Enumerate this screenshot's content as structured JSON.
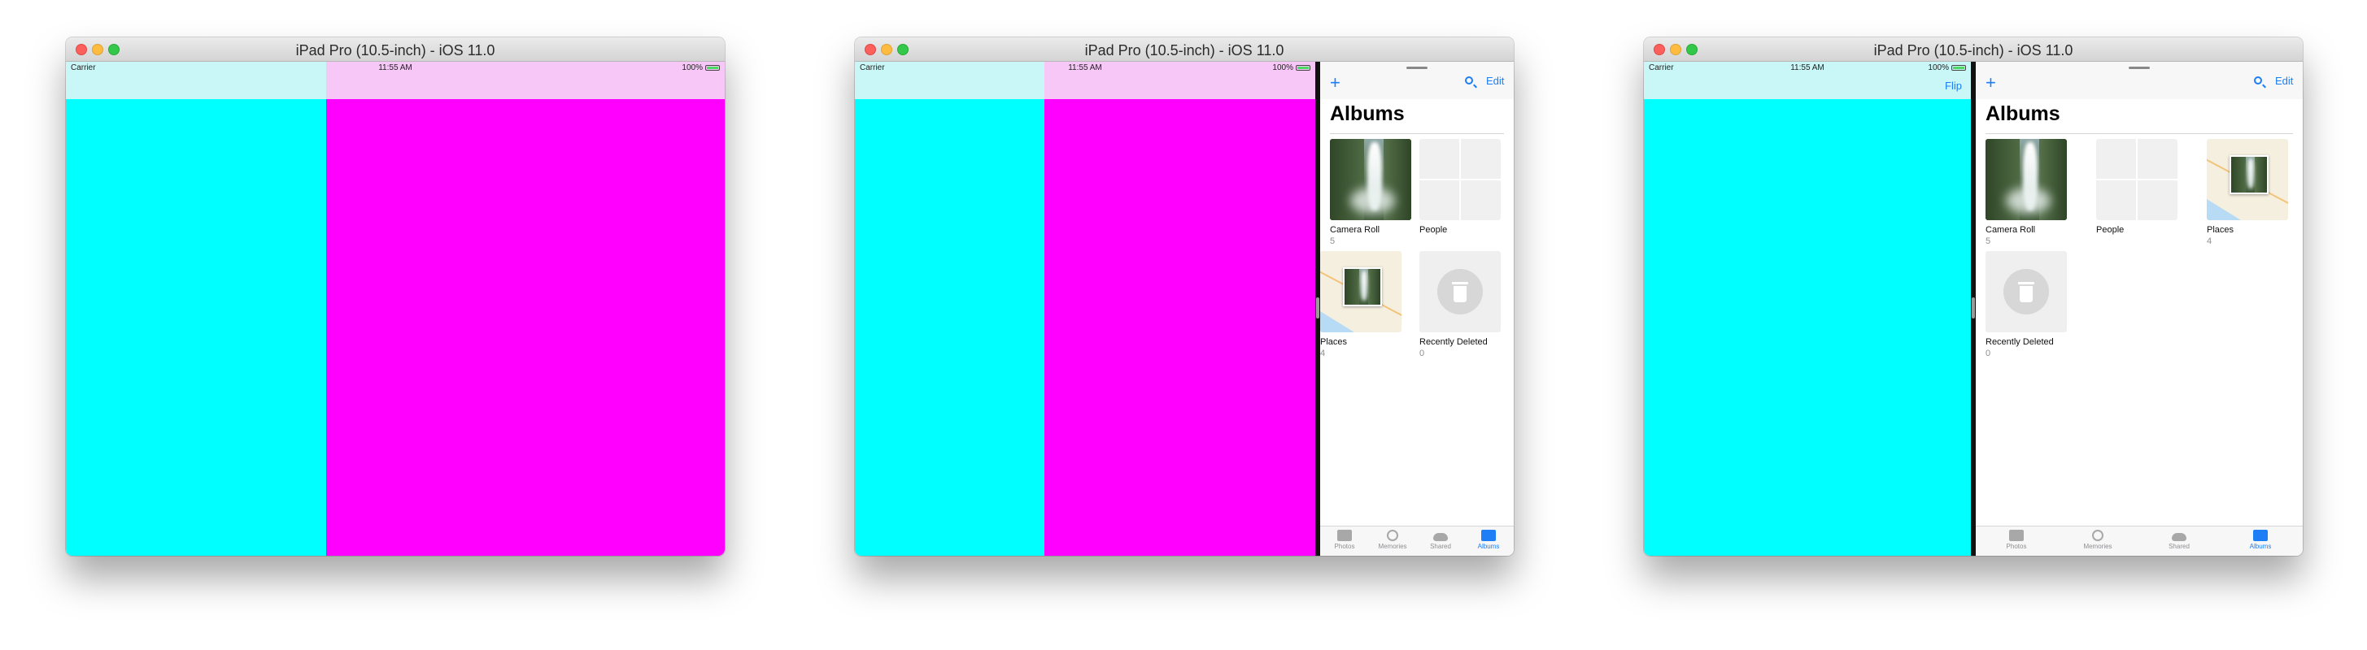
{
  "window_title": "iPad Pro (10.5-inch) - iOS 11.0",
  "status_bar": {
    "carrier": "Carrier",
    "time": "11:55 AM",
    "battery": "100%"
  },
  "colors": {
    "left_pane": "#00ffff",
    "right_pane": "#ff00ff",
    "accent": "#1d7ef5",
    "divider": "#111111"
  },
  "windows": [
    {
      "title": "iPad Pro (10.5-inch) - iOS 11.0"
    },
    {
      "title": "iPad Pro (10.5-inch) - iOS 11.0"
    },
    {
      "title": "iPad Pro (10.5-inch) - iOS 11.0"
    }
  ],
  "photos_app": {
    "header": "Albums",
    "add_icon": "plus-icon",
    "search_icon": "search-icon",
    "edit_label": "Edit",
    "albums": [
      {
        "name": "Camera Roll",
        "count": "5",
        "icon": "waterfall-photo"
      },
      {
        "name": "People",
        "count": "",
        "icon": "people-grid"
      },
      {
        "name": "Places",
        "count": "4",
        "icon": "map-thumbnail"
      },
      {
        "name": "Recently Deleted",
        "count": "0",
        "icon": "trash-icon"
      }
    ],
    "tabs": [
      {
        "label": "Photos",
        "icon": "photos-icon"
      },
      {
        "label": "Memories",
        "icon": "memories-icon"
      },
      {
        "label": "Shared",
        "icon": "cloud-icon"
      },
      {
        "label": "Albums",
        "icon": "albums-icon",
        "selected": true
      }
    ]
  },
  "flip_label": "Flip"
}
